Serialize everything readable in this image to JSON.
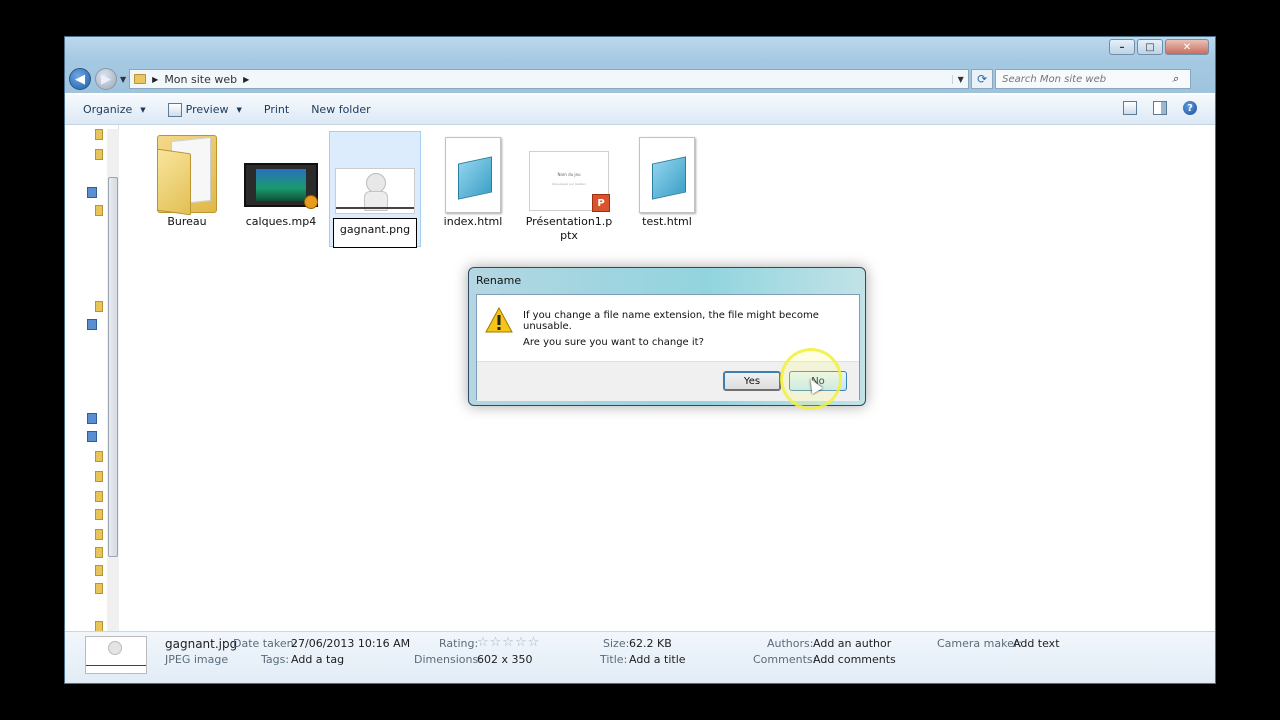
{
  "window": {
    "controls": {
      "minimize": "–",
      "maximize": "□",
      "close": "✕"
    }
  },
  "nav": {
    "breadcrumb": [
      "Mon site web"
    ],
    "search_placeholder": "Search Mon site web"
  },
  "toolbar": {
    "organize": "Organize",
    "preview": "Preview",
    "print": "Print",
    "new_folder": "New folder"
  },
  "files": [
    {
      "name": "Bureau",
      "type": "folder"
    },
    {
      "name": "calques.mp4",
      "type": "video"
    },
    {
      "name": "gagnant.png",
      "type": "image",
      "selected": true,
      "editing": true
    },
    {
      "name": "index.html",
      "type": "html"
    },
    {
      "name": "Présentation1.pptx",
      "type": "pptx"
    },
    {
      "name": "test.html",
      "type": "html"
    }
  ],
  "ppt_preview": {
    "title": "Nom du jeu",
    "subtitle": "Développé par Gaëtan"
  },
  "details": {
    "filename": "gagnant.jpg",
    "filetype": "JPEG image",
    "date_taken_label": "Date taken:",
    "date_taken": "27/06/2013 10:16 AM",
    "tags_label": "Tags:",
    "tags": "Add a tag",
    "rating_label": "Rating:",
    "rating": 0,
    "rating_stars": "☆☆☆☆☆",
    "dimensions_label": "Dimensions:",
    "dimensions": "602 x 350",
    "size_label": "Size:",
    "size": "62.2 KB",
    "title_label": "Title:",
    "title": "Add a title",
    "authors_label": "Authors:",
    "authors": "Add an author",
    "comments_label": "Comments:",
    "comments": "Add comments",
    "camera_label": "Camera maker:",
    "camera": "Add text"
  },
  "dialog": {
    "title": "Rename",
    "message": "If you change a file name extension, the file might become unusable.",
    "question": "Are you sure you want to change it?",
    "yes_label": "Yes",
    "no_label": "No",
    "icon": "warning-icon"
  }
}
